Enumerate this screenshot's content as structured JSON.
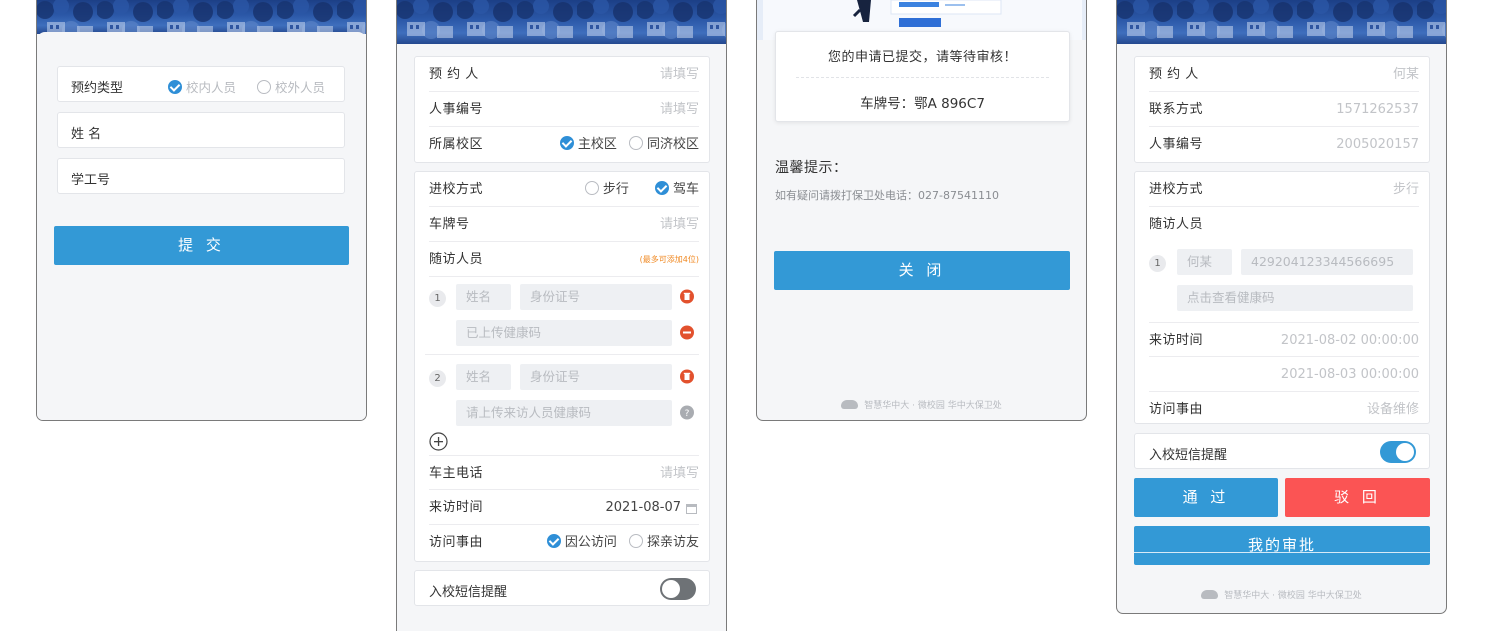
{
  "screen1": {
    "booking_type_label": "预约类型",
    "type_options": [
      "校内人员",
      "校外人员"
    ],
    "name_label": "姓 名",
    "id_label": "学工号",
    "submit_label": "提 交"
  },
  "screen2": {
    "booker_label": "预 约 人",
    "booker_placeholder": "请填写",
    "staff_no_label": "人事编号",
    "staff_no_placeholder": "请填写",
    "campus_label": "所属校区",
    "campus_options": [
      "主校区",
      "同济校区"
    ],
    "entry_mode_label": "进校方式",
    "entry_options": [
      "步行",
      "驾车"
    ],
    "plate_label": "车牌号",
    "plate_placeholder": "请填写",
    "companions_label": "随访人员",
    "companions_hint": "(最多可添加4位)",
    "companions": [
      {
        "index": "1",
        "name_placeholder": "姓名",
        "id_placeholder": "身份证号",
        "health": "已上传健康码"
      },
      {
        "index": "2",
        "name_placeholder": "姓名",
        "id_placeholder": "身份证号",
        "health": "请上传来访人员健康码"
      }
    ],
    "add_icon": "plus-circle-icon",
    "owner_phone_label": "车主电话",
    "owner_phone_placeholder": "请填写",
    "visit_time_label": "来访时间",
    "visit_time_value": "2021-08-07",
    "reason_label": "访问事由",
    "reason_options": [
      "因公访问",
      "探亲访友"
    ],
    "sms_label": "入校短信提醒",
    "sms_on": false
  },
  "screen3": {
    "submitted_msg": "您的申请已提交，请等待审核！",
    "plate_text": "车牌号：鄂A 896C7",
    "tip_title": "温馨提示：",
    "tip_text": "如有疑问请拨打保卫处电话：027-87541110",
    "close_label": "关 闭",
    "footer": "智慧华中大 · 微校园  华中大保卫处"
  },
  "screen4": {
    "booker_label": "预 约 人",
    "booker_value": "何某",
    "contact_label": "联系方式",
    "contact_value": "1571262537",
    "staff_no_label": "人事编号",
    "staff_no_value": "2005020157",
    "entry_mode_label": "进校方式",
    "entry_mode_value": "步行",
    "companions_label": "随访人员",
    "companion": {
      "index": "1",
      "name": "何某",
      "id_no": "429204123344566695",
      "health": "点击查看健康码"
    },
    "visit_time_label": "来访时间",
    "visit_start": "2021-08-02 00:00:00",
    "visit_end": "2021-08-03 00:00:00",
    "reason_label": "访问事由",
    "reason_value": "设备维修",
    "sms_label": "入校短信提醒",
    "sms_on": true,
    "approve_label": "通 过",
    "reject_label": "驳 回",
    "my_approvals_label": "我的审批",
    "footer": "智慧华中大 · 微校园  华中大保卫处"
  },
  "colors": {
    "primary": "#3399d6",
    "danger": "#fb5454",
    "warning": "#f08a24"
  }
}
